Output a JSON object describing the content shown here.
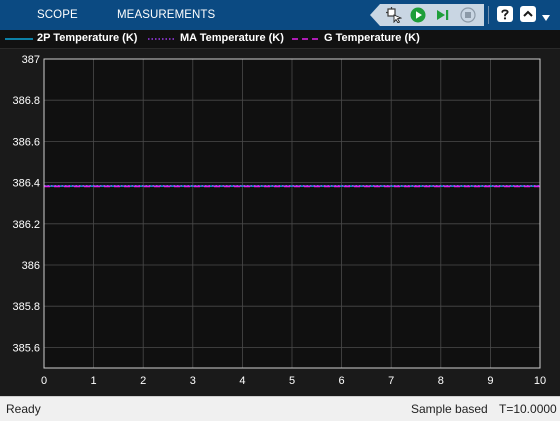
{
  "toolbar": {
    "tabs": [
      {
        "label": "SCOPE"
      },
      {
        "label": "MEASUREMENTS"
      }
    ],
    "icons": [
      "highlight-blocks-icon",
      "run-icon",
      "step-forward-icon",
      "stop-icon",
      "help-icon",
      "collapse-icon"
    ]
  },
  "legend": [
    {
      "label": "2P Temperature (K)",
      "color": "#0aa6d8",
      "style": "solid"
    },
    {
      "label": "MA Temperature (K)",
      "color": "#9e3cf0",
      "style": "dotted"
    },
    {
      "label": "G Temperature (K)",
      "color": "#e020e8",
      "style": "dashed"
    }
  ],
  "chart_data": {
    "type": "line",
    "title": "",
    "xlabel": "",
    "ylabel": "",
    "xlim": [
      0,
      10
    ],
    "ylim": [
      385.5,
      387
    ],
    "xticks": [
      "0",
      "1",
      "2",
      "3",
      "4",
      "5",
      "6",
      "7",
      "8",
      "9",
      "10"
    ],
    "yticks": [
      "385.6",
      "385.8",
      "386",
      "386.2",
      "386.4",
      "386.6",
      "386.8",
      "387"
    ],
    "grid": true,
    "legend_position": "top",
    "series": [
      {
        "name": "2P Temperature (K)",
        "x": [
          0,
          10
        ],
        "values": [
          386.383,
          386.383
        ],
        "color": "#0aa6d8",
        "style": "solid"
      },
      {
        "name": "MA Temperature (K)",
        "x": [
          0,
          10
        ],
        "values": [
          386.385,
          386.385
        ],
        "color": "#9e3cf0",
        "style": "dotted"
      },
      {
        "name": "G Temperature (K)",
        "x": [
          0,
          10
        ],
        "values": [
          386.381,
          386.381
        ],
        "color": "#e020e8",
        "style": "dashed"
      }
    ]
  },
  "status": {
    "left": "Ready",
    "mode": "Sample based",
    "time": "T=10.0000"
  }
}
